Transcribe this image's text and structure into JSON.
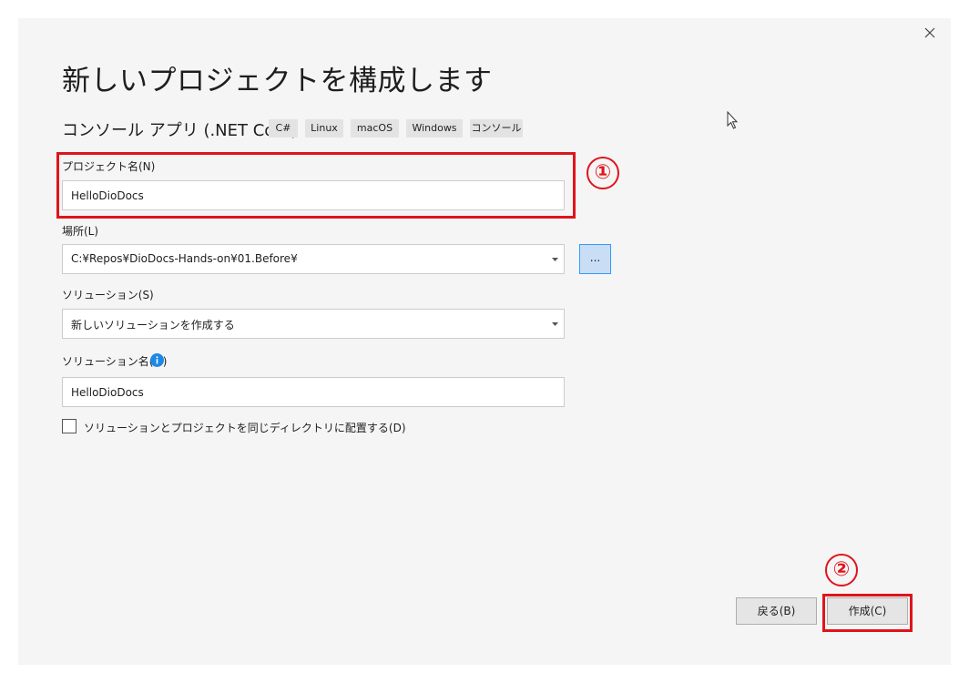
{
  "dialog": {
    "title": "新しいプロジェクトを構成します",
    "template_name": "コンソール アプリ (.NET Core)",
    "tags": [
      "C#",
      "Linux",
      "macOS",
      "Windows",
      "コンソール"
    ]
  },
  "form": {
    "project_name": {
      "label": "プロジェクト名(N)",
      "value": "HelloDioDocs"
    },
    "location": {
      "label": "場所(L)",
      "value": "C:¥Repos¥DioDocs-Hands-on¥01.Before¥",
      "browse_label": "..."
    },
    "solution": {
      "label": "ソリューション(S)",
      "value": "新しいソリューションを作成する"
    },
    "solution_name": {
      "label": "ソリューション名(M)",
      "value": "HelloDioDocs"
    },
    "same_directory": {
      "label": "ソリューションとプロジェクトを同じディレクトリに配置する(D)",
      "checked": false
    }
  },
  "buttons": {
    "back_label": "戻る(B)",
    "create_label": "作成(C)"
  },
  "annotations": {
    "marker_1": "①",
    "marker_2": "②",
    "color": "#e0141b"
  },
  "icons": {
    "close": "close-icon",
    "info": "info-icon",
    "dropdown": "chevron-down-icon",
    "cursor": "cursor-icon"
  },
  "colors": {
    "dialog_background": "#f5f5f5",
    "accent": "#3399ff",
    "info": "#1e88e5"
  }
}
